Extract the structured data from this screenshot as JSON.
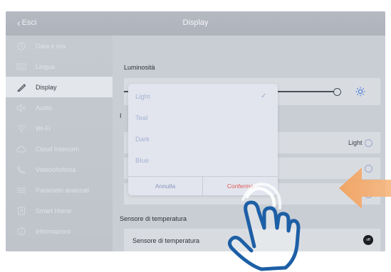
{
  "header": {
    "back_label": "Esci",
    "title": "Display"
  },
  "sidebar": {
    "items": [
      {
        "label": "Data e ora",
        "icon": "clock-icon"
      },
      {
        "label": "Lingua",
        "icon": "keyboard-icon"
      },
      {
        "label": "Display",
        "icon": "pencil-icon"
      },
      {
        "label": "Audio",
        "icon": "speaker-icon"
      },
      {
        "label": "Wi-Fi",
        "icon": "wifi-icon"
      },
      {
        "label": "Cloud Intercom",
        "icon": "cloud-icon"
      },
      {
        "label": "Videocitofonia",
        "icon": "phone-icon"
      },
      {
        "label": "Parametri avanzati",
        "icon": "sliders-icon"
      },
      {
        "label": "Smart Home",
        "icon": "home-icon"
      },
      {
        "label": "Informazioni",
        "icon": "info-icon"
      }
    ]
  },
  "content": {
    "brightness_label": "Luminosità",
    "brightness_level": 1.0,
    "partial_section_letter": "I",
    "theme_value": "Light",
    "temperature_section": "Sensore di temperatura",
    "temperature_row": "Sensore di temperatura",
    "temperature_toggle": "off"
  },
  "dialog": {
    "options": [
      {
        "label": "Light",
        "selected": true
      },
      {
        "label": "Teal",
        "selected": false
      },
      {
        "label": "Dark",
        "selected": false
      },
      {
        "label": "Blue",
        "selected": false
      }
    ],
    "cancel_label": "Annulla",
    "confirm_label": "Conferma"
  },
  "colors": {
    "accent_red": "#e15a57",
    "option_blue": "#a6b2d3",
    "arrow_orange": "#f0a05a",
    "hand_blue": "#1d5fa6"
  }
}
